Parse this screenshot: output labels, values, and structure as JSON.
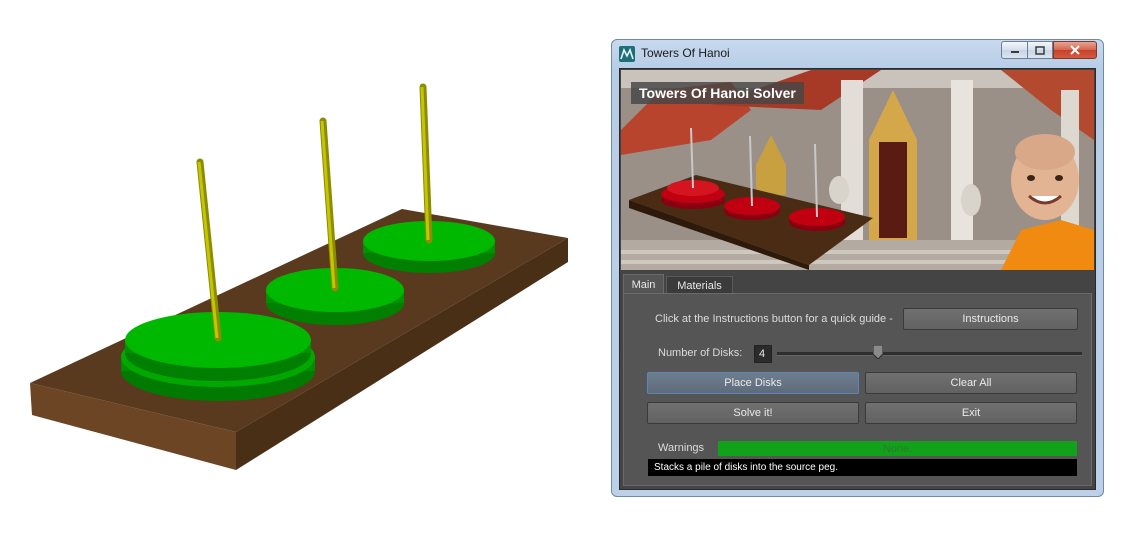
{
  "window": {
    "title": "Towers Of Hanoi"
  },
  "banner": {
    "title": "Towers Of Hanoi Solver"
  },
  "tabs": [
    {
      "label": "Main",
      "selected": true
    },
    {
      "label": "Materials",
      "selected": false
    }
  ],
  "main": {
    "instructions_text": "Click at the Instructions button for a quick guide -",
    "instructions_button": "Instructions",
    "disks_label": "Number of Disks:",
    "disks_value": "4",
    "disks_slider_fraction": 0.33,
    "place_disks_button": "Place Disks",
    "clear_all_button": "Clear All",
    "solve_button": "Solve it!",
    "exit_button": "Exit",
    "warnings_label": "Warnings",
    "warnings_value": "None.",
    "status_text": "Stacks a pile of disks into the source peg."
  },
  "colors": {
    "disk_green": "#00b000",
    "peg_yellow": "#b8b800",
    "base_brown": "#5a3a1e",
    "warning_green": "#11a11a",
    "banner_disk_red": "#c00010"
  },
  "icons": {
    "app": "maya-icon",
    "minimize": "minimize-icon",
    "maximize": "maximize-icon",
    "close": "close-icon"
  }
}
